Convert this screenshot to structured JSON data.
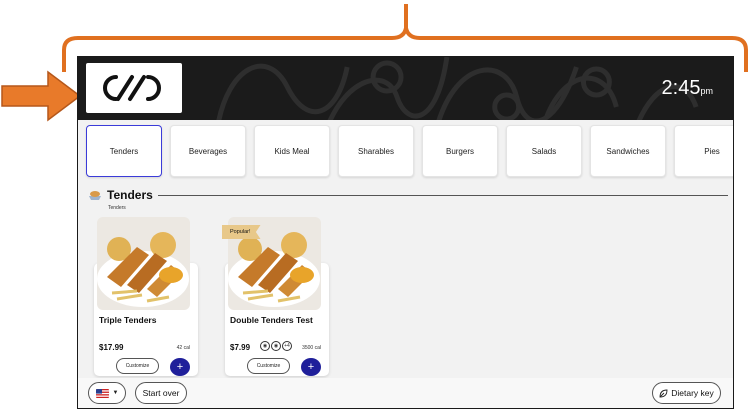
{
  "header": {
    "logo_name": "brand-logo",
    "time": "2:45",
    "ampm": "pm"
  },
  "categories": [
    {
      "label": "Tenders",
      "active": true
    },
    {
      "label": "Beverages",
      "active": false
    },
    {
      "label": "Kids Meal",
      "active": false
    },
    {
      "label": "Sharables",
      "active": false
    },
    {
      "label": "Burgers",
      "active": false
    },
    {
      "label": "Salads",
      "active": false
    },
    {
      "label": "Sandwiches",
      "active": false
    },
    {
      "label": "Pies",
      "active": false
    }
  ],
  "section": {
    "title": "Tenders",
    "subtitle": "Tenders"
  },
  "products": [
    {
      "name": "Triple Tenders",
      "price": "$17.99",
      "calories": "42 cal",
      "customize_label": "Customize",
      "add_label": "+",
      "badge": ""
    },
    {
      "name": "Double Tenders Test",
      "price": "$7.99",
      "calories": "3500 cal",
      "customize_label": "Customize",
      "add_label": "+",
      "badge": "Popular!",
      "allergen_more": "+4"
    }
  ],
  "footer": {
    "start_over_label": "Start over",
    "dietary_key_label": "Dietary key"
  },
  "colors": {
    "annotation": "#E07020",
    "accent": "#1f1f9a",
    "active_border": "#3b3bd9",
    "header_bg": "#1b1b1b"
  }
}
